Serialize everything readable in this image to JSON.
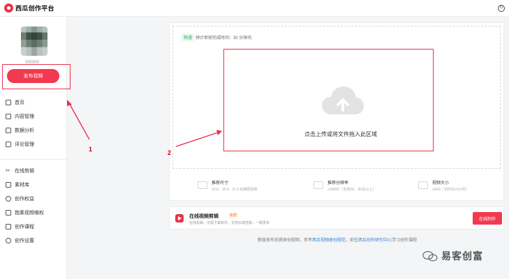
{
  "app": {
    "title": "西瓜创作平台"
  },
  "sidebar": {
    "publish_label": "发布视频",
    "nav_group1": [
      {
        "label": "首页",
        "icon": "home-icon"
      },
      {
        "label": "内容管理",
        "icon": "content-icon"
      },
      {
        "label": "数据分析",
        "icon": "chart-icon"
      },
      {
        "label": "评论管理",
        "icon": "comment-icon"
      }
    ],
    "nav_group2": [
      {
        "label": "在线剪辑",
        "icon": "scissors-icon"
      },
      {
        "label": "素材库",
        "icon": "library-icon"
      },
      {
        "label": "创作权益",
        "icon": "rights-icon"
      },
      {
        "label": "抱素视频维权",
        "icon": "shield-icon"
      },
      {
        "label": "创作课程",
        "icon": "course-icon"
      },
      {
        "label": "创作设置",
        "icon": "settings-icon"
      }
    ]
  },
  "upload": {
    "tag": "畅通",
    "estimate": "预计审核完成时间：30 分钟内",
    "prompt": "点击上传或将文件拖入此区域"
  },
  "specs": [
    {
      "title": "推荐尺寸",
      "sub": "16:9、16:9、21:9 的横屏视频"
    },
    {
      "title": "推荐分辨率",
      "sub": "≥1080P（支持2K、4K及以上）"
    },
    {
      "title": "视频大小",
      "sub": "≤64G（日时长≤3小时）"
    }
  ],
  "online_edit": {
    "title": "在线视频剪辑",
    "badge": "免费",
    "desc": "在线剪辑，无需下载软件，支持云端渲染，一键发布",
    "button": "在线制作"
  },
  "footer": {
    "prefix": "新版发布优质原创视频，参考",
    "link1": "西瓜视频原创规范",
    "middle": "，前往",
    "link2": "西瓜创作研究中心",
    "suffix": "学习创作课程"
  },
  "watermark": "易客创富",
  "annotations": {
    "one": "1",
    "two": "2"
  },
  "colors": {
    "accent": "#f1394f",
    "annotation": "#e8344c"
  }
}
